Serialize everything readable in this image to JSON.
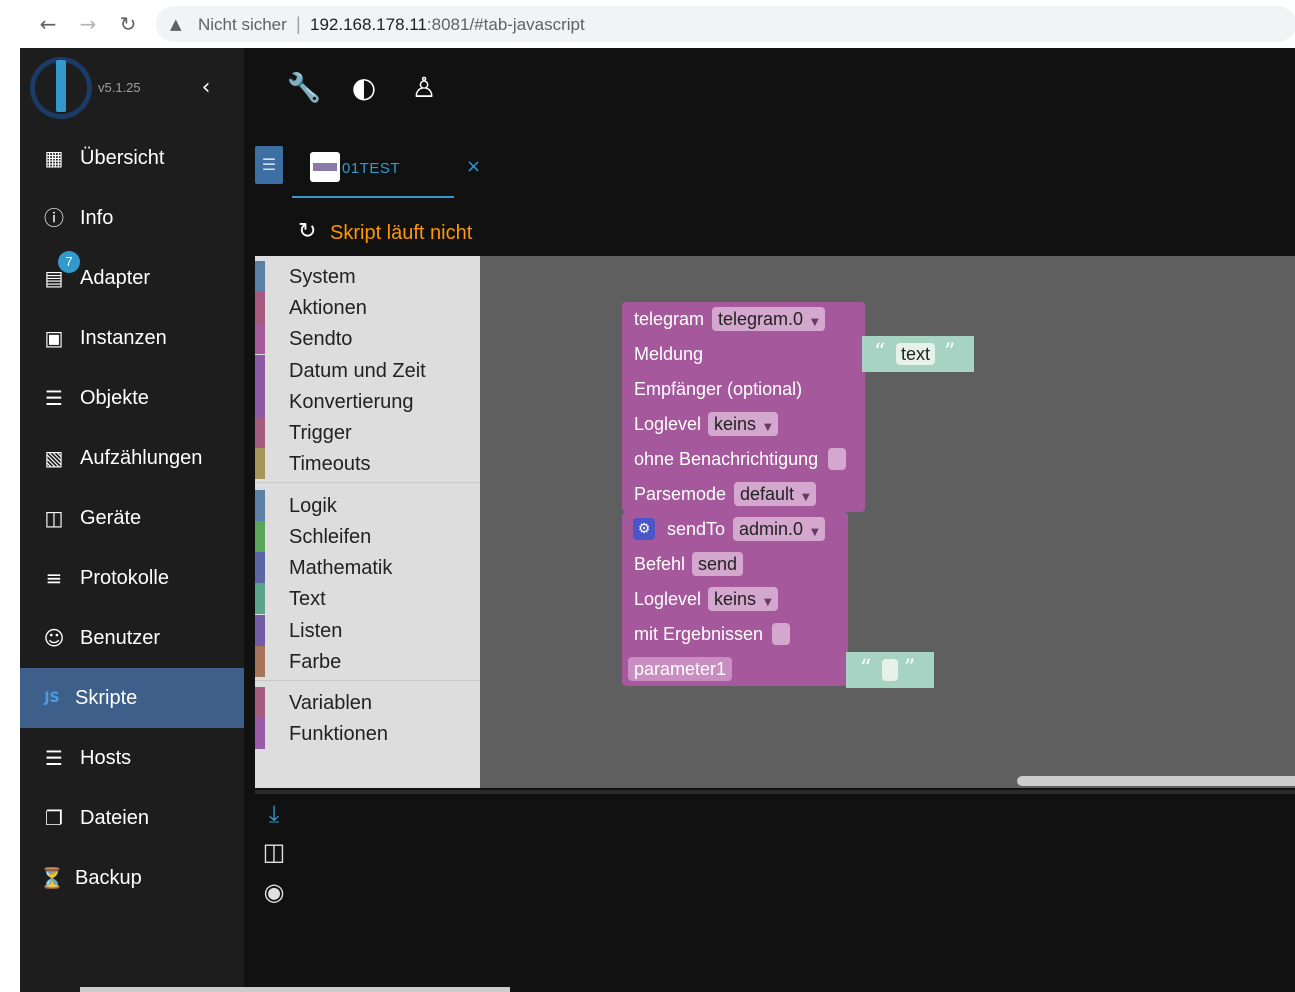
{
  "browser": {
    "back_icon": "arrow-left-icon",
    "forward_icon": "arrow-right-icon",
    "reload_icon": "reload-icon",
    "warning_icon": "warning-triangle-icon",
    "not_secure": "Nicht sicher",
    "separator": "|",
    "url_host": "192.168.178.11",
    "url_rest": ":8081/#tab-javascript"
  },
  "sidebar": {
    "version": "v5.1.25",
    "items": [
      {
        "label": "Übersicht",
        "icon": "apps-grid-icon"
      },
      {
        "label": "Info",
        "icon": "info-icon"
      },
      {
        "label": "Adapter",
        "icon": "store-icon",
        "badge": "7"
      },
      {
        "label": "Instanzen",
        "icon": "instances-icon"
      },
      {
        "label": "Objekte",
        "icon": "list-icon"
      },
      {
        "label": "Aufzählungen",
        "icon": "enum-icon"
      },
      {
        "label": "Geräte",
        "icon": "devices-icon"
      },
      {
        "label": "Protokolle",
        "icon": "logs-icon"
      },
      {
        "label": "Benutzer",
        "icon": "user-icon"
      },
      {
        "label": "Skripte",
        "icon": "javascript-icon",
        "active": true
      },
      {
        "label": "Hosts",
        "icon": "hosts-icon"
      },
      {
        "label": "Dateien",
        "icon": "files-icon"
      },
      {
        "label": "Backup",
        "icon": "backup-icon"
      }
    ]
  },
  "topbar": {
    "icons": [
      "wrench-icon",
      "brightness-icon",
      "expert-mode-icon"
    ]
  },
  "editor": {
    "tab_name": "01TEST",
    "tab_close": "×",
    "status": "Skript läuft nicht"
  },
  "toolbox": {
    "categories": [
      {
        "label": "System",
        "color": "#5b80a5"
      },
      {
        "label": "Aktionen",
        "color": "#a5597e"
      },
      {
        "label": "Sendto",
        "color": "#a55b99"
      },
      {
        "label": "Datum und Zeit",
        "color": "#8c5ba5"
      },
      {
        "label": "Konvertierung",
        "color": "#8c5ba5"
      },
      {
        "label": "Trigger",
        "color": "#a55b80"
      },
      {
        "label": "Timeouts",
        "color": "#a5955b"
      },
      {
        "label": "Logik",
        "color": "#5b80a5"
      },
      {
        "label": "Schleifen",
        "color": "#5ba55b"
      },
      {
        "label": "Mathematik",
        "color": "#5b67a5"
      },
      {
        "label": "Text",
        "color": "#5ba58c"
      },
      {
        "label": "Listen",
        "color": "#745ba5"
      },
      {
        "label": "Farbe",
        "color": "#a5745b"
      },
      {
        "label": "Variablen",
        "color": "#a55b80"
      },
      {
        "label": "Funktionen",
        "color": "#995ba5"
      }
    ]
  },
  "blocks": {
    "telegram": {
      "title": "telegram",
      "instance": "telegram.0",
      "message_label": "Meldung",
      "message_text": "text",
      "recipient_label": "Empfänger (optional)",
      "loglevel_label": "Loglevel",
      "loglevel_value": "keins",
      "silent_label": "ohne Benachrichtigung",
      "parsemode_label": "Parsemode",
      "parsemode_value": "default"
    },
    "sendto": {
      "title": "sendTo",
      "instance": "admin.0",
      "command_label": "Befehl",
      "command_value": "send",
      "loglevel_label": "Loglevel",
      "loglevel_value": "keins",
      "results_label": "mit Ergebnissen",
      "param_label": "parameter1"
    },
    "dropdown_arrow": "▼",
    "open_quote": "“",
    "close_quote": "”"
  },
  "lower": {
    "icons": [
      "download-icon",
      "split-view-icon",
      "eye-off-icon"
    ]
  }
}
